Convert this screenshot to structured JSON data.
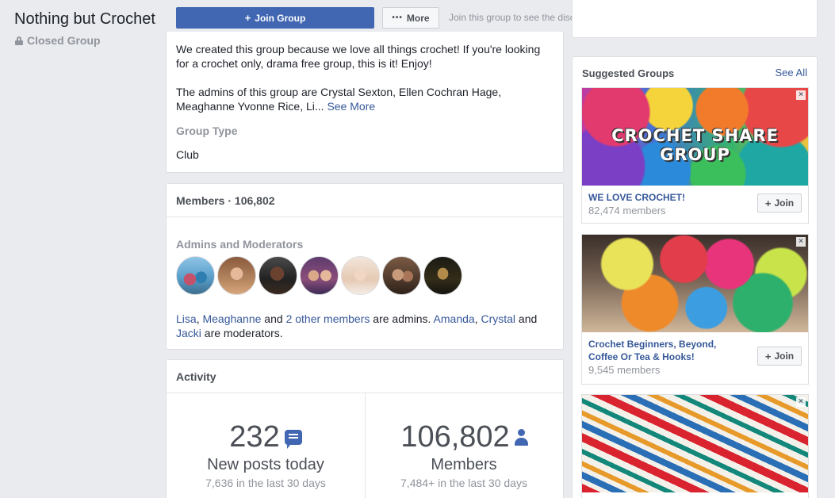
{
  "group": {
    "title": "Nothing but Crochet",
    "privacy": "Closed Group"
  },
  "topbar": {
    "join_label": "Join Group",
    "more_label": "More",
    "hint": "Join this group to see the discussion, post and comment."
  },
  "about": {
    "paragraph1": "We created this group because we love all things crochet! If you're looking for a crochet only, drama free group,  this is it! Enjoy!",
    "paragraph2": "The admins of this group are Crystal Sexton, Ellen Cochran Hage, Meaghanne Yvonne Rice, Li...",
    "see_more": "See More",
    "group_type_label": "Group Type",
    "group_type_value": "Club"
  },
  "members": {
    "header": "Members · 106,802",
    "admins_label": "Admins and Moderators",
    "desc": {
      "lisa": "Lisa",
      "sep1": ", ",
      "meaghanne": "Meaghanne",
      "and1": " and ",
      "others": "2 other members",
      "are_admins": " are admins. ",
      "amanda": "Amanda",
      "sep2": ", ",
      "crystal": "Crystal",
      "and2": " and ",
      "jacki": "Jacki",
      "are_mods": " are moderators."
    }
  },
  "activity": {
    "header": "Activity",
    "posts_number": "232",
    "posts_label": "New posts today",
    "posts_sub": "7,636 in the last 30 days",
    "members_number": "106,802",
    "members_label": "Members",
    "members_sub": "7,484+ in the last 30 days"
  },
  "suggested": {
    "title": "Suggested Groups",
    "see_all": "See All",
    "join_label": "Join",
    "close_glyph": "×",
    "items": [
      {
        "image_text": "CROCHET SHARE GROUP",
        "name": "WE LOVE CROCHET!",
        "members": "82,474 members"
      },
      {
        "name_line1": "Crochet Beginners, Beyond,",
        "name_line2": "Coffee Or Tea & Hooks!",
        "members": "9,545 members"
      }
    ]
  },
  "icons": {
    "plus": "+",
    "dots": "•••"
  }
}
